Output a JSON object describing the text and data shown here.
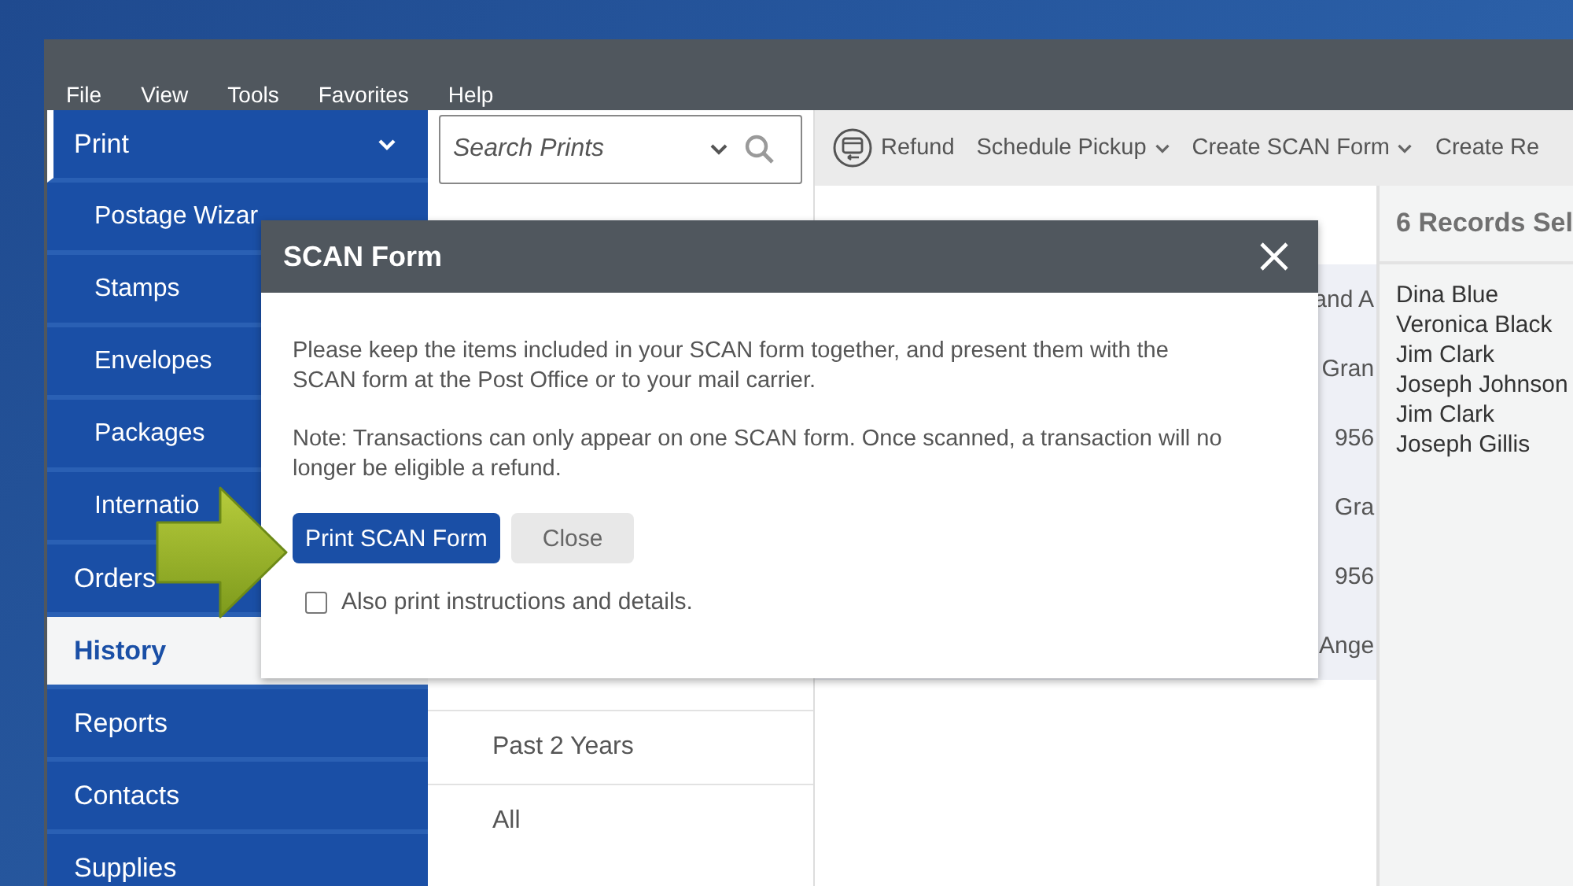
{
  "menu": [
    "File",
    "View",
    "Tools",
    "Favorites",
    "Help"
  ],
  "sidebar": {
    "items": [
      {
        "label": "Print",
        "selected": false,
        "expanded": true,
        "children": [
          {
            "label": "Postage Wizar",
            "selected": false
          },
          {
            "label": "Stamps",
            "selected": false
          },
          {
            "label": "Envelopes",
            "selected": false
          },
          {
            "label": "Packages",
            "selected": false
          },
          {
            "label": "Internatio",
            "selected": false
          }
        ]
      },
      {
        "label": "Orders",
        "selected": false
      },
      {
        "label": "History",
        "selected": true
      },
      {
        "label": "Reports",
        "selected": false
      },
      {
        "label": "Contacts",
        "selected": false
      },
      {
        "label": "Supplies",
        "selected": false
      }
    ]
  },
  "search": {
    "placeholder": "Search Prints"
  },
  "date_filters": [
    "Past 2 Years",
    "All"
  ],
  "toolbar": [
    {
      "label": "Refund",
      "kind": "icon"
    },
    {
      "label": "Schedule Pickup",
      "kind": "dropdown"
    },
    {
      "label": "Create SCAN Form",
      "kind": "dropdown"
    },
    {
      "label": "Create Re",
      "kind": "plain"
    }
  ],
  "list_rows": [
    "and A",
    "Gran",
    "956",
    "Gra",
    "956",
    "Ange"
  ],
  "details": {
    "title": "6 Records Sel",
    "names": [
      "Dina Blue",
      "Veronica Black",
      "Jim Clark",
      "Joseph Johnson",
      "Jim Clark",
      "Joseph Gillis"
    ]
  },
  "dialog": {
    "title": "SCAN Form",
    "paragraphs": [
      "Please keep the items included in your SCAN form together, and present them with the SCAN form at the Post Office or to your mail carrier.",
      "Note: Transactions can only appear on one SCAN form. Once scanned, a transaction will no longer be eligible a refund."
    ],
    "buttons": [
      {
        "label": "Print SCAN Form",
        "kind": "primary"
      },
      {
        "label": "Close",
        "kind": "secondary"
      }
    ],
    "checkbox": {
      "label": "Also print instructions and details.",
      "checked": false
    }
  }
}
